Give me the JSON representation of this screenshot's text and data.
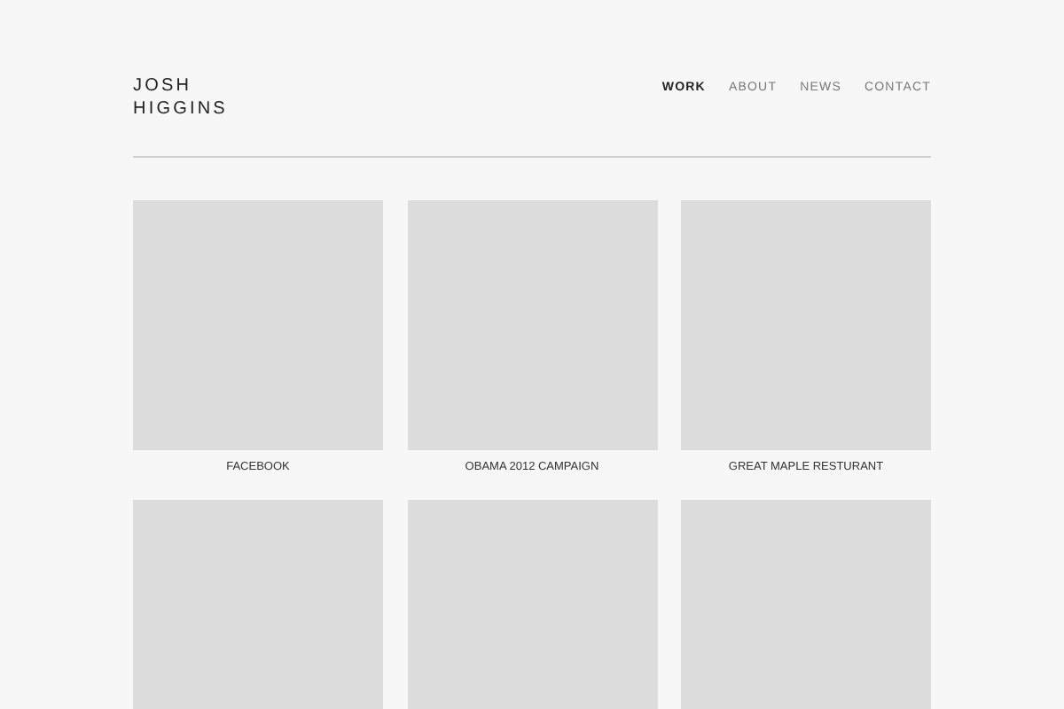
{
  "logo": {
    "lines": [
      "JOSH",
      "HIGGINS"
    ]
  },
  "nav": [
    {
      "label": "WORK",
      "selected": true
    },
    {
      "label": "ABOUT",
      "selected": false
    },
    {
      "label": "NEWS",
      "selected": false
    },
    {
      "label": "CONTACT",
      "selected": false
    }
  ],
  "projects": [
    {
      "kind": "tile",
      "title": "FACEBOOK"
    },
    {
      "kind": "tile",
      "title": "OBAMA 2012 CAMPAIGN"
    },
    {
      "kind": "tile",
      "title": "GREAT MAPLE RESTURANT"
    },
    {
      "kind": "tile"
    },
    {
      "kind": "tile"
    },
    {
      "kind": "tile"
    }
  ]
}
